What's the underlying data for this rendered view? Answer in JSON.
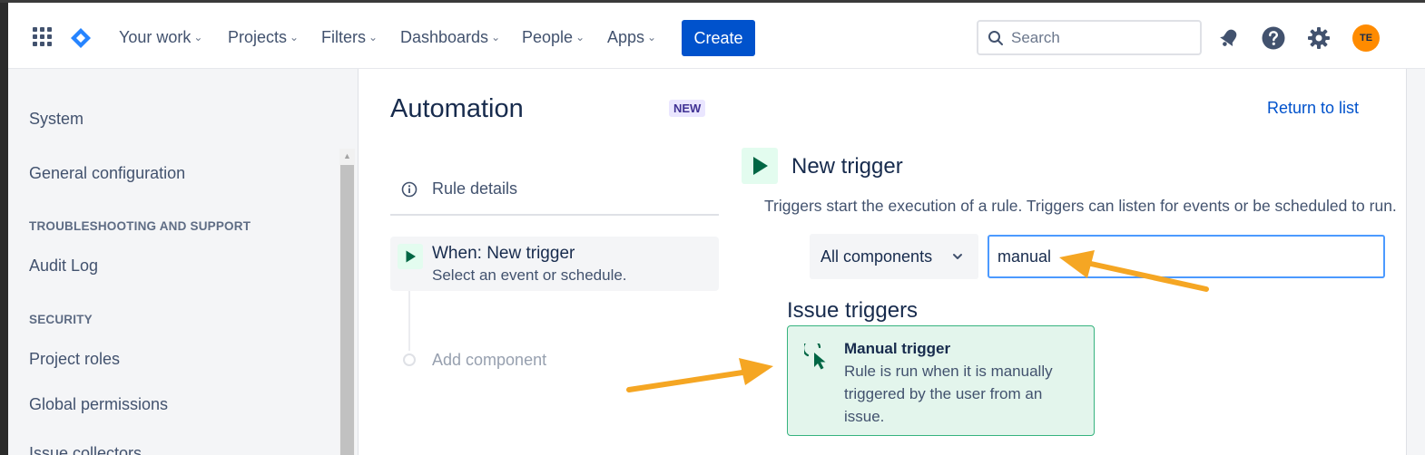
{
  "header": {
    "nav": [
      {
        "label": "Your work"
      },
      {
        "label": "Projects"
      },
      {
        "label": "Filters"
      },
      {
        "label": "Dashboards"
      },
      {
        "label": "People"
      },
      {
        "label": "Apps"
      }
    ],
    "create_label": "Create",
    "search_placeholder": "Search",
    "avatar_initials": "TE",
    "icons": [
      "app-switcher-icon",
      "jira-logo-icon",
      "notifications-icon",
      "help-icon",
      "settings-icon"
    ]
  },
  "sidebar": {
    "title": "System",
    "general_config": "General configuration",
    "troubleshooting_heading": "TROUBLESHOOTING AND SUPPORT",
    "audit_log": "Audit Log",
    "security_heading": "SECURITY",
    "project_roles": "Project roles",
    "global_permissions": "Global permissions",
    "issue_collectors": "Issue collectors"
  },
  "main": {
    "title": "Automation",
    "badge": "NEW",
    "return_link": "Return to list",
    "steps": {
      "rule_details": "Rule details",
      "when_title": "When: New trigger",
      "when_subtitle": "Select an event or schedule.",
      "add_component": "Add component"
    },
    "trigger_panel": {
      "title": "New trigger",
      "description": "Triggers start the execution of a rule. Triggers can listen for events or be scheduled to run.",
      "component_filter": "All components",
      "search_value": "manual",
      "section_heading": "Issue triggers",
      "card_title": "Manual trigger",
      "card_description": "Rule is run when it is manually triggered by the user from an issue."
    }
  },
  "colors": {
    "primary": "#0052cc",
    "success_green": "#00875a",
    "card_bg": "#e3f5ec",
    "avatar": "#ff8b00",
    "annotation_arrow": "#f5a623"
  }
}
